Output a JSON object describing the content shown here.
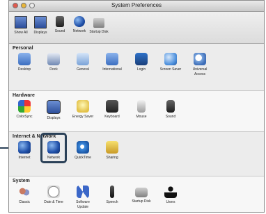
{
  "window": {
    "title": "System Preferences"
  },
  "toolbar": {
    "items": [
      {
        "label": "Show All",
        "icon": "monitor-icon"
      },
      {
        "label": "Displays",
        "icon": "displays-icon"
      },
      {
        "label": "Sound",
        "icon": "speaker-icon"
      },
      {
        "label": "Network",
        "icon": "network-icon"
      },
      {
        "label": "Startup Disk",
        "icon": "disk-icon"
      }
    ]
  },
  "sections": {
    "personal": {
      "title": "Personal",
      "items": [
        {
          "label": "Desktop",
          "icon": "desktop-icon"
        },
        {
          "label": "Dock",
          "icon": "dock-icon"
        },
        {
          "label": "General",
          "icon": "general-icon"
        },
        {
          "label": "International",
          "icon": "flag-icon"
        },
        {
          "label": "Login",
          "icon": "login-icon"
        },
        {
          "label": "Screen Saver",
          "icon": "screen-saver-icon"
        },
        {
          "label": "Universal",
          "label2": "Access",
          "icon": "universal-access-icon"
        }
      ]
    },
    "hardware": {
      "title": "Hardware",
      "items": [
        {
          "label": "ColorSync",
          "icon": "colorsync-icon"
        },
        {
          "label": "Displays",
          "icon": "displays-icon"
        },
        {
          "label": "Energy Saver",
          "icon": "energy-saver-icon"
        },
        {
          "label": "Keyboard",
          "icon": "keyboard-icon"
        },
        {
          "label": "Mouse",
          "icon": "mouse-icon"
        },
        {
          "label": "Sound",
          "icon": "speaker-icon"
        }
      ]
    },
    "internet": {
      "title": "Internet & Network",
      "items": [
        {
          "label": "Internet",
          "icon": "globe-icon"
        },
        {
          "label": "Network",
          "icon": "network-globe-icon"
        },
        {
          "label": "QuickTime",
          "icon": "quicktime-icon"
        },
        {
          "label": "Sharing",
          "icon": "sharing-icon"
        }
      ]
    },
    "system": {
      "title": "System",
      "items": [
        {
          "label": "Classic",
          "icon": "classic-icon"
        },
        {
          "label": "Date & Time",
          "icon": "clock-icon"
        },
        {
          "label": "Software",
          "label2": "Update",
          "icon": "software-update-icon"
        },
        {
          "label": "Speech",
          "icon": "microphone-icon"
        },
        {
          "label": "Startup Disk",
          "icon": "disk-icon"
        },
        {
          "label": "Users",
          "icon": "users-icon"
        }
      ]
    }
  },
  "highlight": {
    "target": "Network"
  }
}
